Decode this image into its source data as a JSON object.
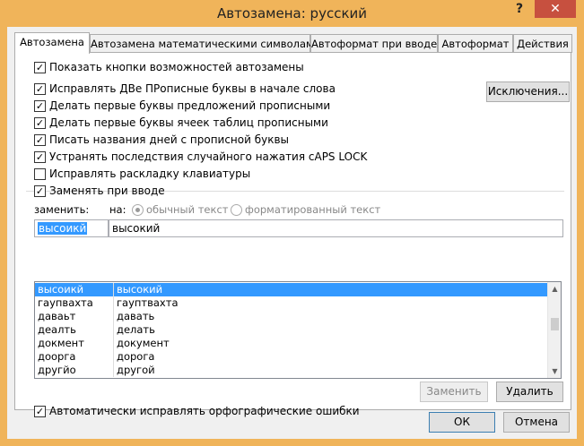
{
  "window": {
    "title": "Автозамена: русский",
    "help_icon": "?",
    "close_icon": "✕"
  },
  "tabs": [
    {
      "label": "Автозамена",
      "active": true
    },
    {
      "label": "Автозамена математическими символами"
    },
    {
      "label": "Автоформат при вводе"
    },
    {
      "label": "Автоформат"
    },
    {
      "label": "Действия"
    }
  ],
  "options": {
    "show_buttons": {
      "label": "Показать кнопки возможностей автозамены",
      "checked": true
    },
    "fix_two_caps": {
      "label": "Исправлять ДВе ПРописные буквы в начале слова",
      "checked": true
    },
    "capitalize_sentence": {
      "label": "Делать первые буквы предложений прописными",
      "checked": true
    },
    "capitalize_table_cells": {
      "label": "Делать первые буквы ячеек таблиц прописными",
      "checked": true
    },
    "capitalize_days": {
      "label": "Писать названия дней с прописной буквы",
      "checked": true
    },
    "fix_caps_lock": {
      "label": "Устранять последствия случайного нажатия cAPS LOCK",
      "checked": true
    },
    "fix_keyboard_layout": {
      "label": "Исправлять раскладку клавиатуры",
      "checked": false
    },
    "replace_as_you_type": {
      "label": "Заменять при вводе",
      "checked": true
    },
    "auto_spelling": {
      "label": "Автоматически исправлять орфографические ошибки",
      "checked": true
    }
  },
  "exceptions_button": "Исключения...",
  "replace": {
    "replace_label": "заменить:",
    "with_label": "на:",
    "plain_text_label": "обычный текст",
    "formatted_text_label": "форматированный текст",
    "plain_selected": true,
    "replace_value": "высоикй",
    "with_value": "высокий"
  },
  "entries": [
    {
      "from": "высоикй",
      "to": "высокий",
      "selected": true
    },
    {
      "from": "гаупвахта",
      "to": "гауптвахта"
    },
    {
      "from": "даваьт",
      "to": "давать"
    },
    {
      "from": "деалть",
      "to": "делать"
    },
    {
      "from": "докмент",
      "to": "документ"
    },
    {
      "from": "доорга",
      "to": "дорога"
    },
    {
      "from": "другйо",
      "to": "другой"
    }
  ],
  "scroll_up_icon": "▲",
  "scroll_down_icon": "▼",
  "buttons": {
    "replace": "Заменить",
    "delete": "Удалить",
    "ok": "ОК",
    "cancel": "Отмена"
  }
}
